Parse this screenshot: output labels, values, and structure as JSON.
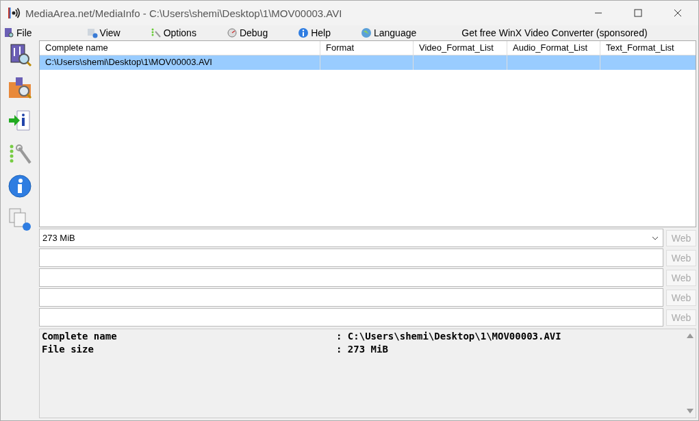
{
  "window": {
    "title": "MediaArea.net/MediaInfo - C:\\Users\\shemi\\Desktop\\1\\MOV00003.AVI"
  },
  "menu": [
    {
      "label": "File",
      "kind": "menu"
    },
    {
      "label": "View",
      "kind": "menu"
    },
    {
      "label": "Options",
      "kind": "menu"
    },
    {
      "label": "Debug",
      "kind": "menu"
    },
    {
      "label": "Help",
      "kind": "menu"
    },
    {
      "label": "Language",
      "kind": "menu"
    },
    {
      "label": "Get free WinX Video Converter (sponsored)",
      "kind": "link"
    }
  ],
  "table": {
    "columns": [
      "Complete name",
      "Format",
      "Video_Format_List",
      "Audio_Format_List",
      "Text_Format_List"
    ],
    "rows": [
      {
        "selected": true,
        "cells": [
          "C:\\Users\\shemi\\Desktop\\1\\MOV00003.AVI",
          "",
          "",
          "",
          ""
        ]
      }
    ]
  },
  "fields": [
    {
      "kind": "combo",
      "value": "273 MiB",
      "button": "Web",
      "disabled": true
    },
    {
      "kind": "text",
      "button": "Web",
      "disabled": true
    },
    {
      "kind": "text",
      "button": "Web",
      "disabled": true
    },
    {
      "kind": "text",
      "button": "Web",
      "disabled": true
    },
    {
      "kind": "text",
      "button": "Web",
      "disabled": true
    }
  ],
  "report": [
    {
      "key": "Complete name",
      "value": ": C:\\Users\\shemi\\Desktop\\1\\MOV00003.AVI"
    },
    {
      "key": "File size",
      "value": ": 273 MiB"
    }
  ]
}
